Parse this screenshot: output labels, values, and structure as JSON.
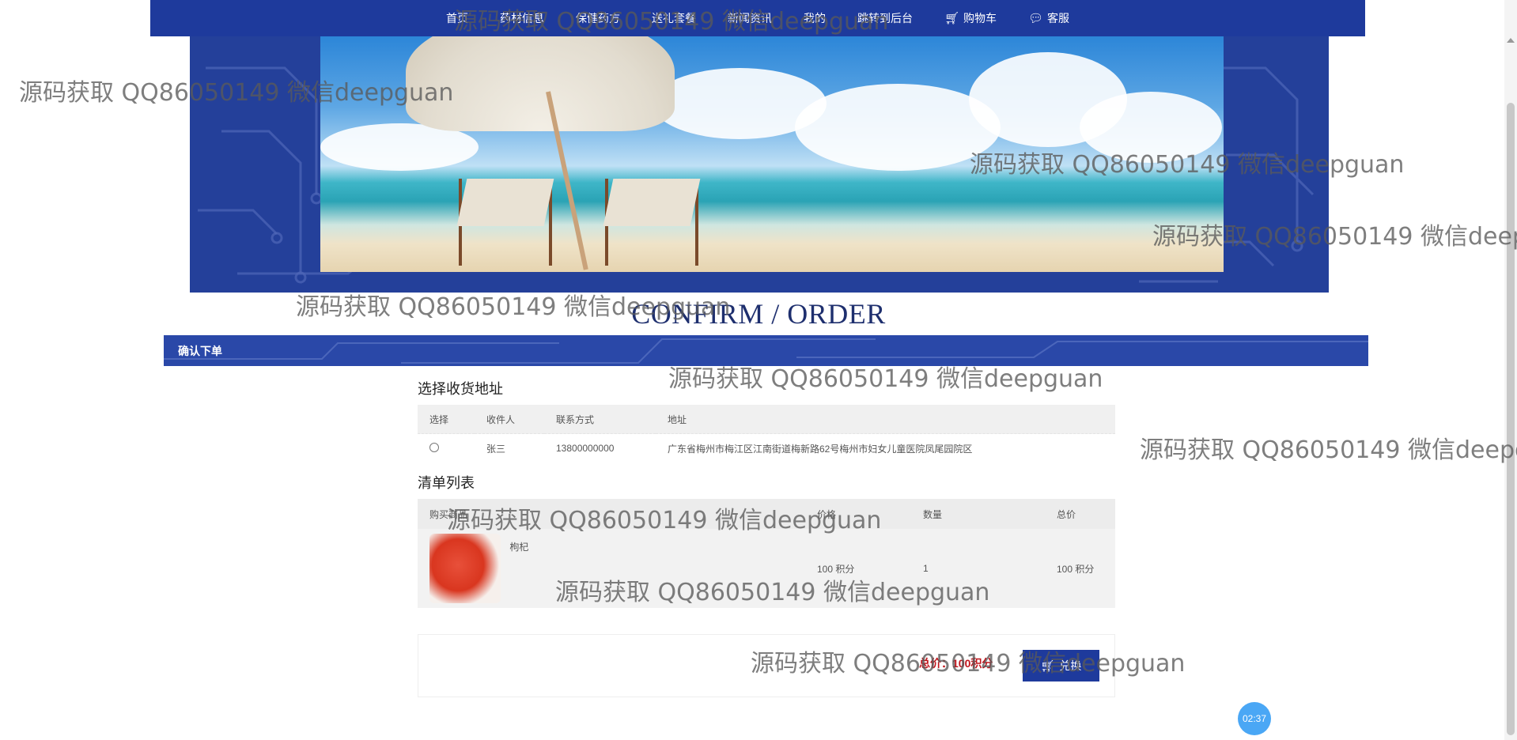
{
  "nav": {
    "items": [
      {
        "label": "首页"
      },
      {
        "label": "药材信息"
      },
      {
        "label": "保健药方"
      },
      {
        "label": "送礼套餐"
      },
      {
        "label": "新闻资讯"
      },
      {
        "label": "我的"
      },
      {
        "label": "跳转到后台"
      },
      {
        "label": "购物车",
        "icon": "cart-icon"
      },
      {
        "label": "客服",
        "icon": "chat-icon"
      }
    ]
  },
  "page_title": "CONFIRM / ORDER",
  "section_title": "确认下单",
  "address": {
    "heading": "选择收货地址",
    "columns": [
      "选择",
      "收件人",
      "联系方式",
      "地址"
    ],
    "rows": [
      {
        "recipient": "张三",
        "phone": "13800000000",
        "address": "广东省梅州市梅江区江南街道梅新路62号梅州市妇女儿童医院凤尾园院区"
      }
    ]
  },
  "items": {
    "heading": "清单列表",
    "columns": [
      "购买商品",
      "价格",
      "数量",
      "总价"
    ],
    "rows": [
      {
        "name": "枸杞",
        "price": "100 积分",
        "qty": "1",
        "total": "100 积分"
      }
    ]
  },
  "summary": {
    "total_label": "总价：100积分",
    "exchange_button": "兑换"
  },
  "timer": "02:37",
  "watermark": "源码获取 QQ86050149 微信deepguan",
  "colors": {
    "nav": "#1e3a9c",
    "accent": "#c0141b",
    "timer": "#4aa7f5"
  }
}
